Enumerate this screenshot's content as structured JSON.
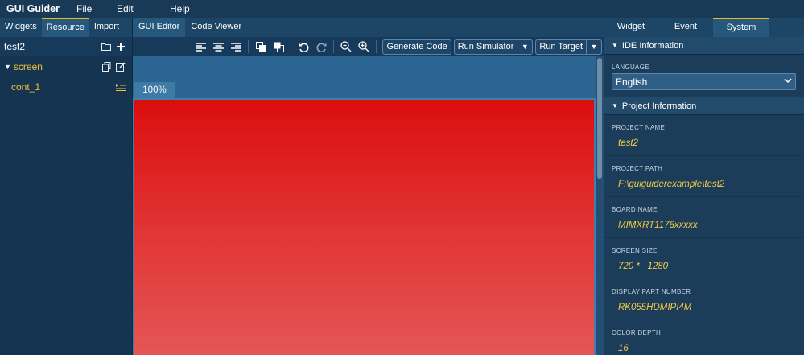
{
  "menu": {
    "app_title": "GUI Guider",
    "items": [
      "File",
      "Edit",
      "Help"
    ]
  },
  "left_panel": {
    "tabs": [
      {
        "label": "Widgets",
        "active": false
      },
      {
        "label": "Resource",
        "active": true
      },
      {
        "label": "Import",
        "active": false
      }
    ],
    "project_name": "test2",
    "tree": {
      "root": "screen",
      "children": [
        "cont_1"
      ]
    }
  },
  "center": {
    "tabs": [
      {
        "label": "GUI Editor",
        "active": true
      },
      {
        "label": "Code Viewer",
        "active": false
      }
    ],
    "toolbar": {
      "icons": [
        "align-left-icon",
        "align-center-icon",
        "align-right-icon",
        "bring-front-icon",
        "send-back-icon",
        "undo-icon",
        "redo-icon",
        "zoom-out-icon",
        "zoom-in-icon"
      ],
      "generate_code": "Generate Code",
      "run_simulator": "Run Simulator",
      "run_target": "Run Target"
    },
    "zoom_label": "100%",
    "screen_gradient": [
      "#db0e0e",
      "#e45858"
    ]
  },
  "right_panel": {
    "tabs": [
      {
        "label": "Widget",
        "active": false
      },
      {
        "label": "Event",
        "active": false
      },
      {
        "label": "System",
        "active": true
      }
    ],
    "ide_section": "IDE Information",
    "language_label": "LANGUAGE",
    "language_value": "English",
    "project_section": "Project Information",
    "fields": [
      {
        "label": "PROJECT NAME",
        "value": "test2"
      },
      {
        "label": "PROJECT PATH",
        "value": "F:\\guiguiderexample\\test2"
      },
      {
        "label": "BOARD NAME",
        "value": "MIMXRT1176xxxxx"
      },
      {
        "label": "SCREEN SIZE",
        "value": "720 *   1280"
      },
      {
        "label": "DISPLAY PART NUMBER",
        "value": "RK055HDMIPI4M"
      },
      {
        "label": "COLOR DEPTH",
        "value": "16"
      }
    ]
  },
  "colors": {
    "accent": "#f0b820",
    "value_text": "#f4c948",
    "panel_bg": "#1b3d5a"
  }
}
